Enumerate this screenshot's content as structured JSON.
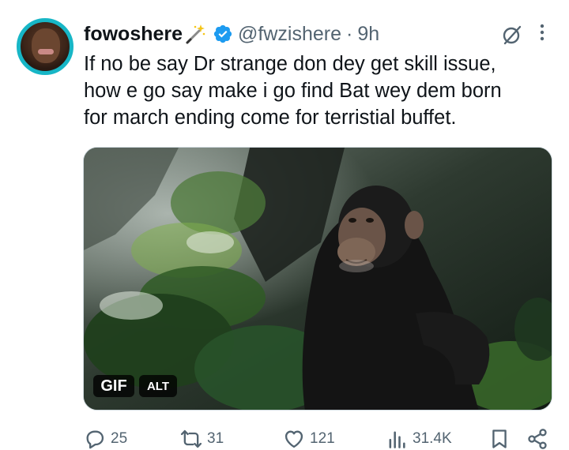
{
  "tweet": {
    "display_name": "fowoshere",
    "handle": "@fwzishere",
    "separator": "·",
    "time": "9h",
    "text": "If no be say Dr strange don dey get skill issue,\nhow e go say make i go find Bat wey dem born\nfor march ending come for terristial buffet.",
    "media": {
      "gif_label": "GIF",
      "alt_label": "ALT"
    },
    "stats": {
      "replies": "25",
      "reposts": "31",
      "likes": "121",
      "views": "31.4K"
    }
  },
  "icons": {
    "verified": "verified-badge-icon",
    "grok": "grok-icon",
    "more": "more-options-icon",
    "reply": "reply-icon",
    "repost": "repost-icon",
    "like": "heart-icon",
    "views": "views-icon",
    "bookmark": "bookmark-icon",
    "share": "share-icon"
  },
  "colors": {
    "accent": "#1d9bf0",
    "text": "#0f1419",
    "secondary": "#536471"
  }
}
